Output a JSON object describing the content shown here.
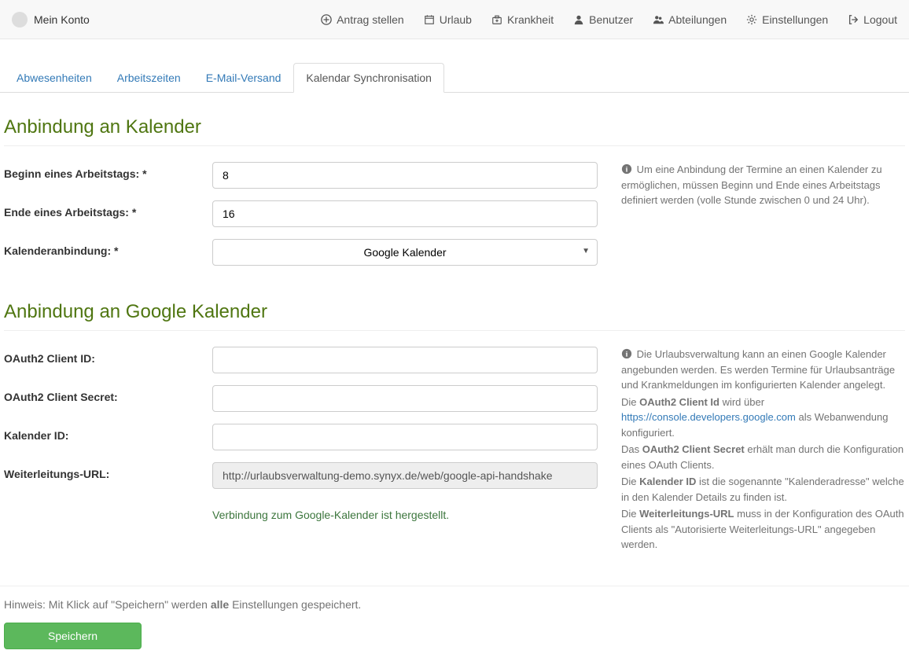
{
  "navbar": {
    "account": "Mein Konto",
    "items": [
      {
        "label": "Antrag stellen",
        "icon": "plus-circle"
      },
      {
        "label": "Urlaub",
        "icon": "calendar"
      },
      {
        "label": "Krankheit",
        "icon": "medkit"
      },
      {
        "label": "Benutzer",
        "icon": "user"
      },
      {
        "label": "Abteilungen",
        "icon": "users"
      },
      {
        "label": "Einstellungen",
        "icon": "gear"
      },
      {
        "label": "Logout",
        "icon": "sign-out"
      }
    ]
  },
  "tabs": [
    {
      "label": "Abwesenheiten",
      "active": false
    },
    {
      "label": "Arbeitszeiten",
      "active": false
    },
    {
      "label": "E-Mail-Versand",
      "active": false
    },
    {
      "label": "Kalendar Synchronisation",
      "active": true
    }
  ],
  "section1": {
    "heading": "Anbindung an Kalender",
    "workday_start_label": "Beginn eines Arbeitstags: *",
    "workday_start_value": "8",
    "workday_end_label": "Ende eines Arbeitstags: *",
    "workday_end_value": "16",
    "provider_label": "Kalenderanbindung: *",
    "provider_value": "Google Kalender",
    "help": "Um eine Anbindung der Termine an einen Kalender zu ermöglichen, müssen Beginn und Ende eines Arbeitstags definiert werden (volle Stunde zwischen 0 und 24 Uhr)."
  },
  "section2": {
    "heading": "Anbindung an Google Kalender",
    "client_id_label": "OAuth2 Client ID:",
    "client_id_value": "",
    "client_secret_label": "OAuth2 Client Secret:",
    "client_secret_value": "",
    "calendar_id_label": "Kalender ID:",
    "calendar_id_value": "",
    "redirect_label": "Weiterleitungs-URL:",
    "redirect_value": "http://urlaubsverwaltung-demo.synyx.de/web/google-api-handshake",
    "success": "Verbindung zum Google-Kalender ist hergestellt.",
    "help": {
      "p1": "Die Urlaubsverwaltung kann an einen Google Kalender angebunden werden. Es werden Termine für Urlaubsanträge und Krankmeldungen im konfigurierten Kalender angelegt.",
      "p2a": "Die ",
      "p2b": "OAuth2 Client Id",
      "p2c": " wird über ",
      "p2link": "https://console.developers.google.com",
      "p2d": " als Webanwendung konfiguriert.",
      "p3a": "Das ",
      "p3b": "OAuth2 Client Secret",
      "p3c": " erhält man durch die Konfiguration eines OAuth Clients.",
      "p4a": "Die ",
      "p4b": "Kalender ID",
      "p4c": " ist die sogenannte \"Kalenderadresse\" welche in den Kalender Details zu finden ist.",
      "p5a": "Die ",
      "p5b": "Weiterleitungs-URL",
      "p5c": " muss in der Konfiguration des OAuth Clients als \"Autorisierte Weiterleitungs-URL\" angegeben werden."
    }
  },
  "footer": {
    "hint_a": "Hinweis: Mit Klick auf \"Speichern\" werden ",
    "hint_b": "alle",
    "hint_c": " Einstellungen gespeichert.",
    "save": "Speichern"
  }
}
